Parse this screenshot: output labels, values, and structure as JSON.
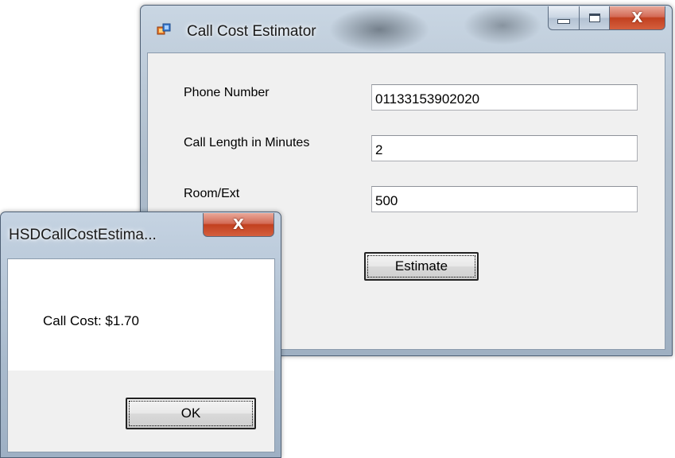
{
  "main_window": {
    "title": "Call Cost Estimator",
    "icon": "form-app-icon",
    "caption_buttons": {
      "minimize_icon": "minimize-icon",
      "maximize_icon": "maximize-icon",
      "close_glyph": "X"
    },
    "fields": {
      "phone_label": "Phone Number",
      "phone_value": "01133153902020",
      "length_label": "Call Length in Minutes",
      "length_value": "2",
      "room_label": "Room/Ext",
      "room_value": "500"
    },
    "estimate_button": "Estimate"
  },
  "message_box": {
    "title": "HSDCallCostEstima...",
    "close_glyph": "X",
    "message": "Call Cost: $1.70",
    "ok_button": "OK"
  },
  "colors": {
    "close_button": "#c94a2c",
    "dialog_face": "#f0f0f0",
    "titlebar": "#aebdcc"
  }
}
